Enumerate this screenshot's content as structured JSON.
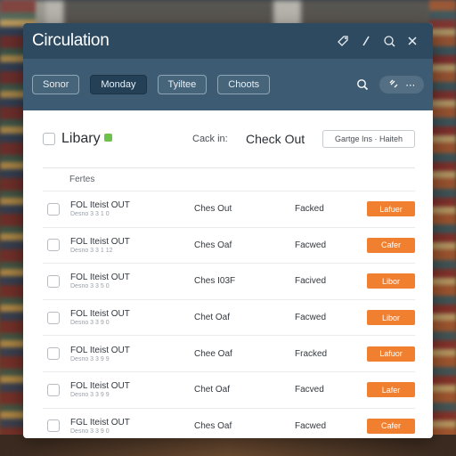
{
  "window": {
    "title": "Circulation"
  },
  "titlebar_icons": [
    "tag-icon",
    "pencil-icon",
    "help-icon",
    "close-icon"
  ],
  "toolbar": {
    "buttons": [
      {
        "label": "Sonor",
        "active": false
      },
      {
        "label": "Monday",
        "active": true
      },
      {
        "label": "Tyiltee",
        "active": false
      },
      {
        "label": "Choots",
        "active": false
      }
    ],
    "search_icon": "search-icon",
    "pill_icon": "link-icon"
  },
  "filter": {
    "library_label": "Libary",
    "checkin_label": "Cack in:",
    "checkout_label": "Check Out",
    "dropdown_value": "Gartge Ins · Haiteh"
  },
  "table": {
    "column_header": "Fertes",
    "rows": [
      {
        "title": "FOL Iteist OUT",
        "subtitle": "Desno 3 3 1 0",
        "status": "Ches Out",
        "state": "Facked",
        "action": "Lafuer"
      },
      {
        "title": "FOL Iteist OUT",
        "subtitle": "Desno 3 3 1 12",
        "status": "Ches Oaf",
        "state": "Facwed",
        "action": "Cafer"
      },
      {
        "title": "FOL Iteist OUT",
        "subtitle": "Desno 3 3 5 0",
        "status": "Ches I03F",
        "state": "Facived",
        "action": "Libor"
      },
      {
        "title": "FOL Iteist OUT",
        "subtitle": "Desno 3 3 9 0",
        "status": "Chet Oaf",
        "state": "Facwed",
        "action": "Libor"
      },
      {
        "title": "FOL Iteist OUT",
        "subtitle": "Desno 3 3 9 9",
        "status": "Chee Oaf",
        "state": "Fracked",
        "action": "Lafuor"
      },
      {
        "title": "FOL Iteist OUT",
        "subtitle": "Desno 3 3 9 9",
        "status": "Chet Oaf",
        "state": "Facved",
        "action": "Lafer"
      },
      {
        "title": "FGL Iteist OUT",
        "subtitle": "Desno 3 3 9 0",
        "status": "Ches Oaf",
        "state": "Facwed",
        "action": "Cafer"
      }
    ]
  },
  "colors": {
    "titlebar": "#2e4a60",
    "toolbar": "#3d5c73",
    "accent": "#f08030",
    "new_badge": "#6cc24a"
  }
}
